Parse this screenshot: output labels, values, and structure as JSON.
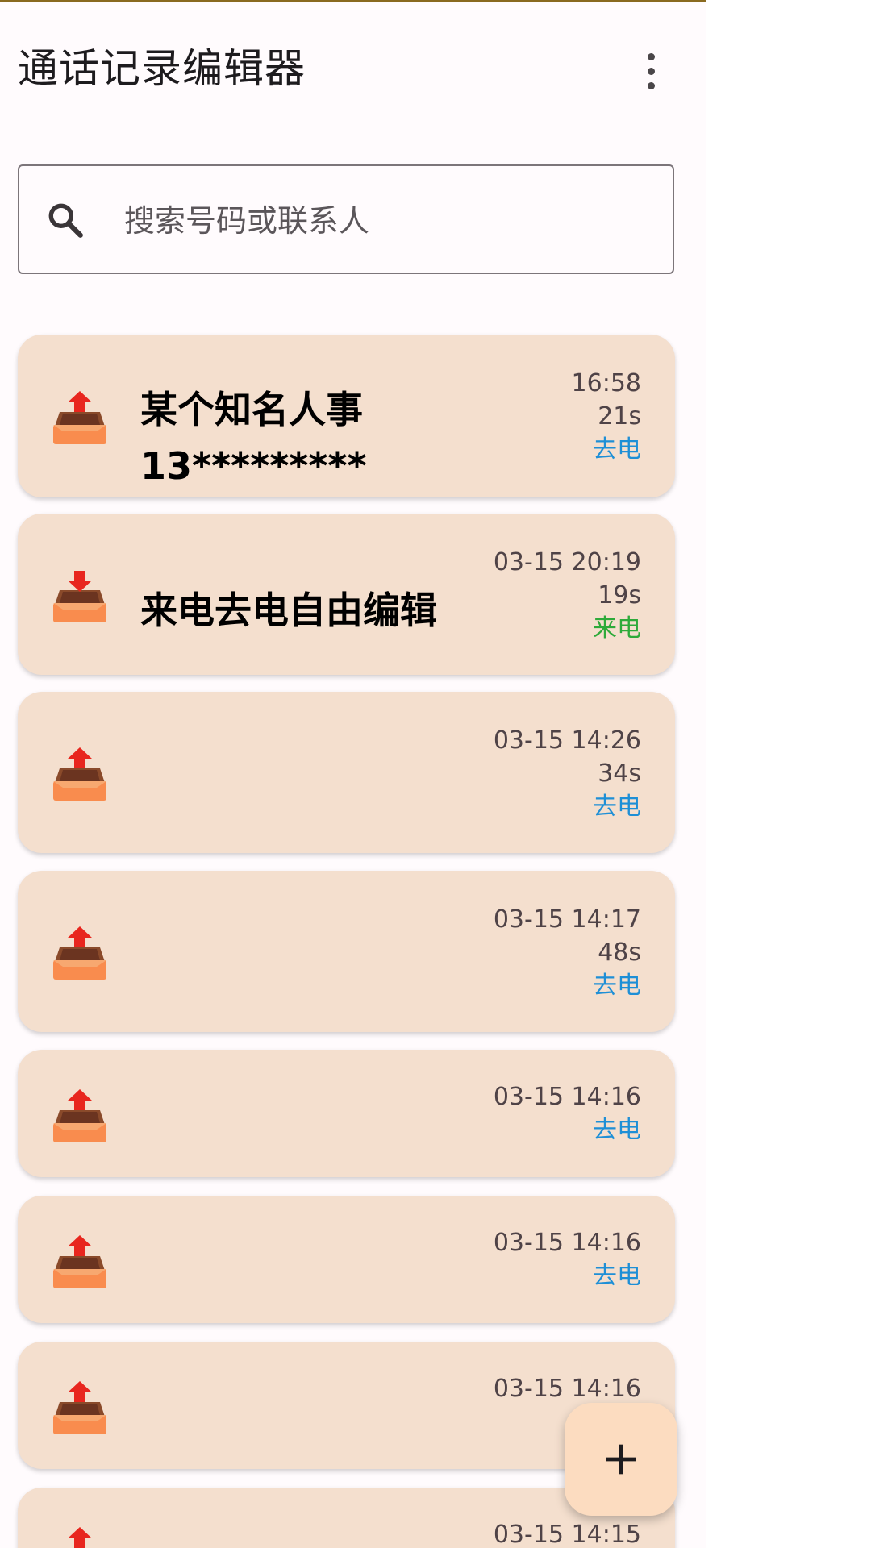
{
  "app": {
    "title": "通话记录编辑器",
    "menu_icon": "more-vert-icon"
  },
  "search": {
    "placeholder": "搜索号码或联系人",
    "value": "",
    "icon": "search-icon"
  },
  "colors": {
    "card_bg": "#f4dfce",
    "outgoing": "#1e8fd6",
    "incoming": "#2eaa3a",
    "fab_bg": "#fcdcc0"
  },
  "calls": [
    {
      "name": "某个知名人事",
      "number": "13*********",
      "time": "16:58",
      "duration": "21s",
      "type": "去电",
      "direction": "outgoing",
      "icon": "outgoing-call-icon"
    },
    {
      "name": "来电去电自由编辑",
      "number": "",
      "time": "03-15 20:19",
      "duration": "19s",
      "type": "来电",
      "direction": "incoming",
      "icon": "incoming-call-icon"
    },
    {
      "name": "",
      "number": "",
      "time": "03-15 14:26",
      "duration": "34s",
      "type": "去电",
      "direction": "outgoing",
      "icon": "outgoing-call-icon"
    },
    {
      "name": "",
      "number": "",
      "time": "03-15 14:17",
      "duration": "48s",
      "type": "去电",
      "direction": "outgoing",
      "icon": "outgoing-call-icon"
    },
    {
      "name": "",
      "number": "",
      "time": "03-15 14:16",
      "duration": "",
      "type": "去电",
      "direction": "outgoing",
      "icon": "outgoing-call-icon"
    },
    {
      "name": "",
      "number": "",
      "time": "03-15 14:16",
      "duration": "",
      "type": "去电",
      "direction": "outgoing",
      "icon": "outgoing-call-icon"
    },
    {
      "name": "",
      "number": "",
      "time": "03-15 14:16",
      "duration": "",
      "type": "",
      "direction": "outgoing",
      "icon": "outgoing-call-icon"
    },
    {
      "name": "",
      "number": "",
      "time": "03-15 14:15",
      "duration": "",
      "type": "",
      "direction": "outgoing",
      "icon": "outgoing-call-icon"
    }
  ],
  "fab": {
    "label": "+",
    "icon": "add-icon"
  }
}
